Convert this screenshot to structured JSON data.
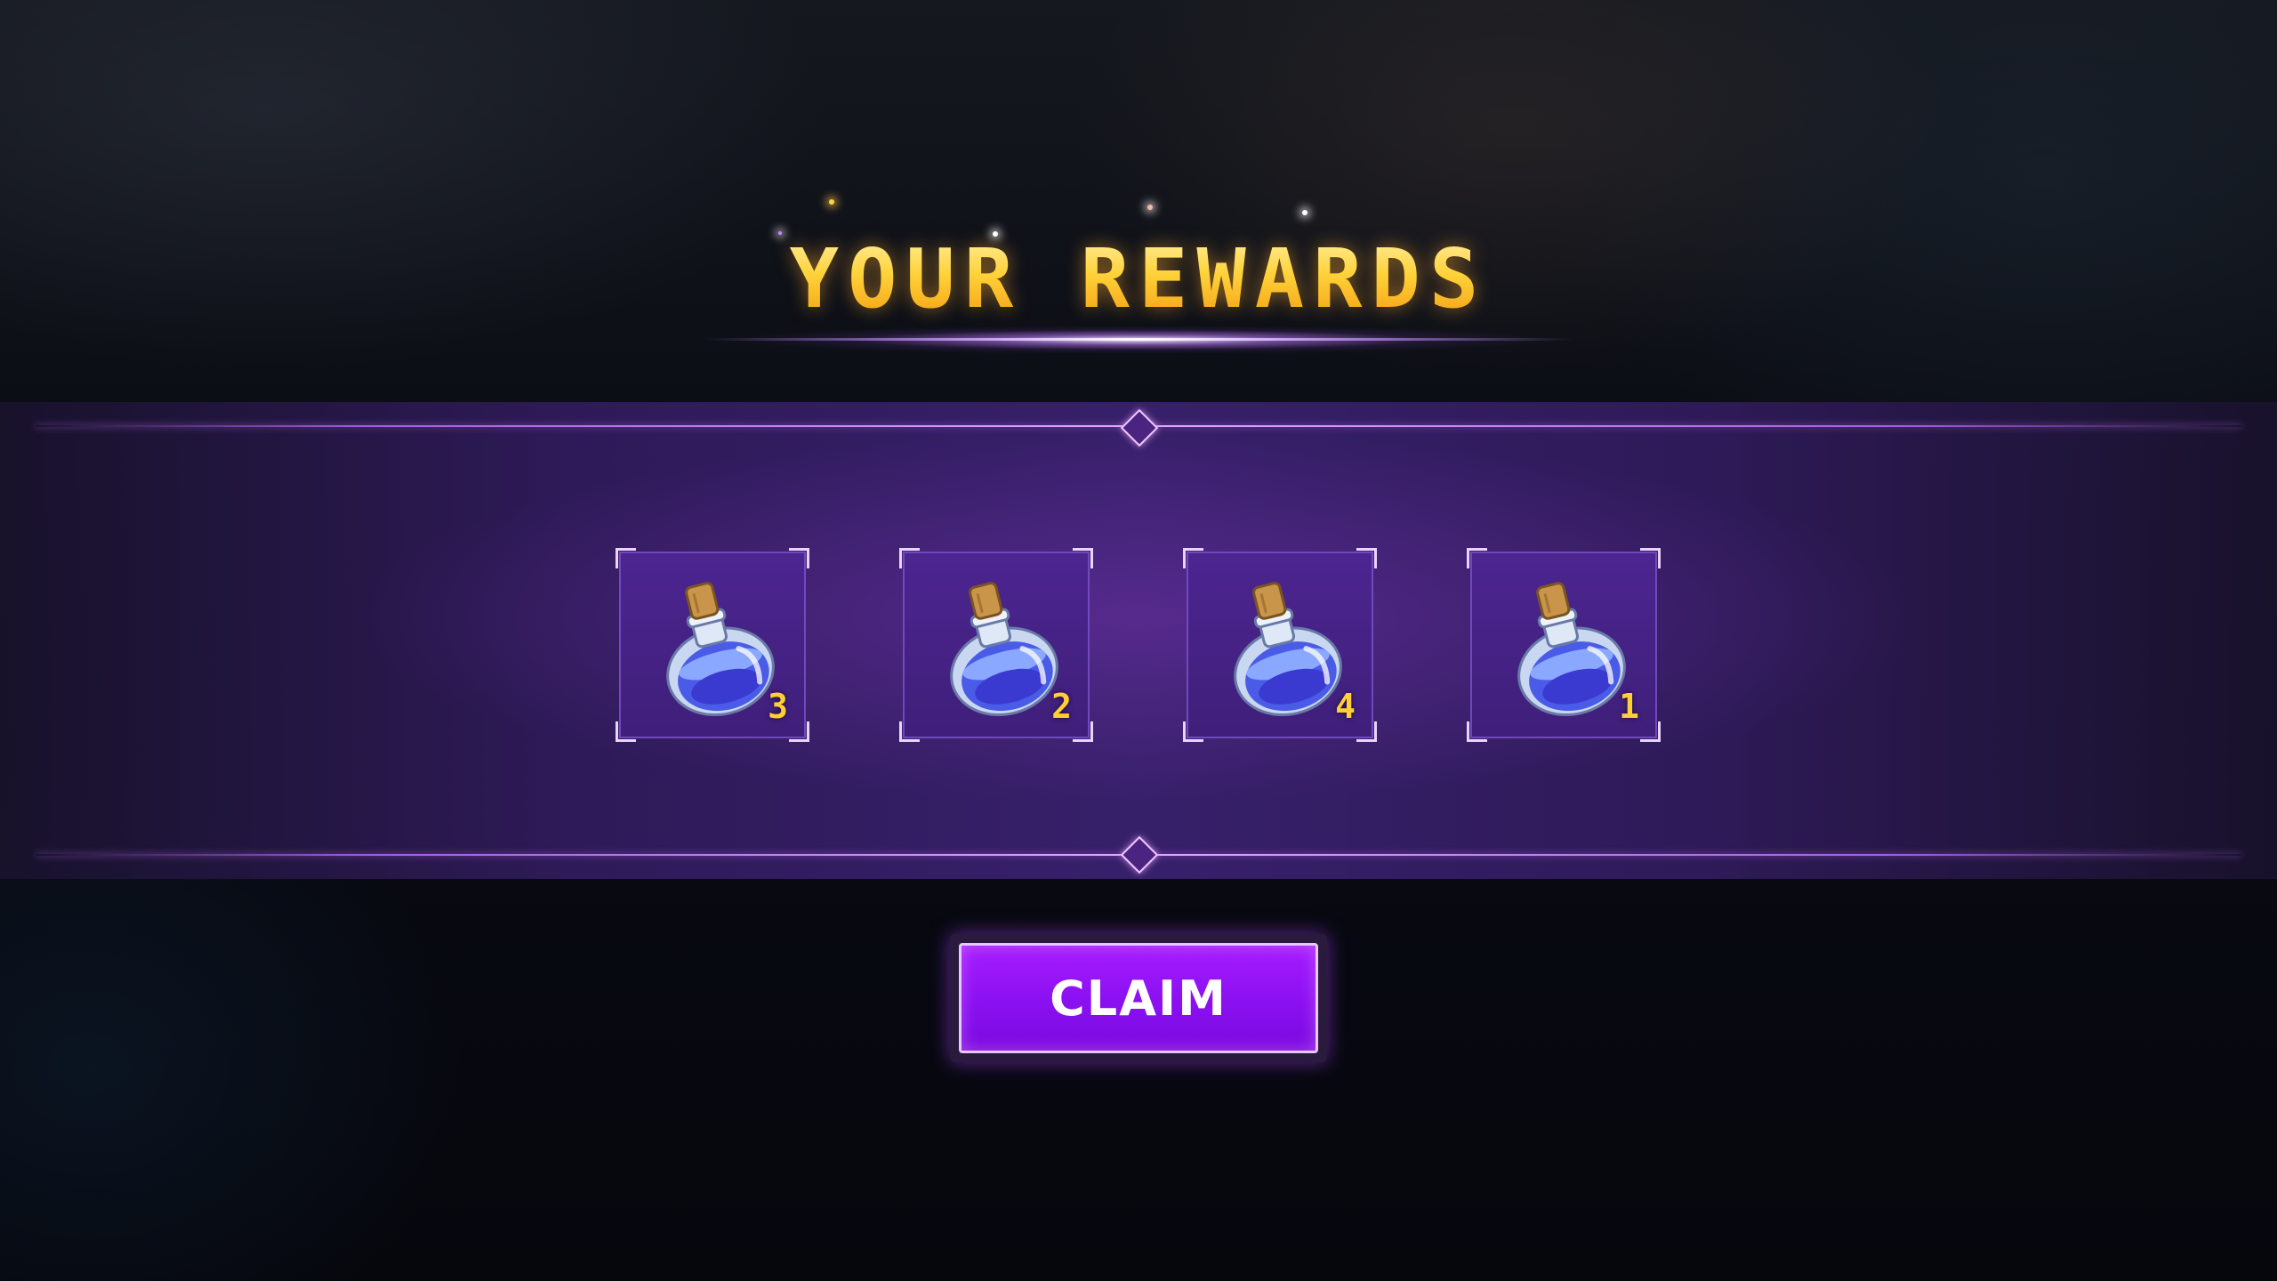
{
  "header": {
    "title": "YOUR REWARDS"
  },
  "rewards": [
    {
      "icon": "mana-potion-icon",
      "quantity": "3"
    },
    {
      "icon": "mana-potion-icon",
      "quantity": "2"
    },
    {
      "icon": "mana-potion-icon",
      "quantity": "4"
    },
    {
      "icon": "mana-potion-icon",
      "quantity": "1"
    }
  ],
  "actions": {
    "claim_label": "CLAIM"
  },
  "colors": {
    "title_gold": "#ffc824",
    "panel_purple": "#37206a",
    "button_purple": "#8a10f0",
    "quantity_gold": "#ffcf35"
  }
}
